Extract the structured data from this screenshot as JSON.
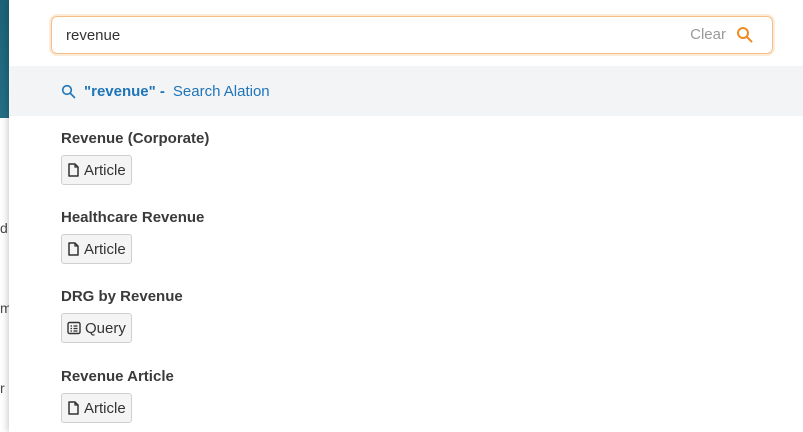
{
  "search": {
    "value": "revenue",
    "clear_label": "Clear"
  },
  "suggestion": {
    "term": "\"revenue\" -",
    "action": "Search Alation"
  },
  "results": [
    {
      "title": "Revenue (Corporate)",
      "type": "Article",
      "icon": "article-icon"
    },
    {
      "title": "Healthcare Revenue",
      "type": "Article",
      "icon": "article-icon"
    },
    {
      "title": "DRG by Revenue",
      "type": "Query",
      "icon": "query-icon"
    },
    {
      "title": "Revenue Article",
      "type": "Article",
      "icon": "article-icon"
    }
  ],
  "background_fragments": [
    "d",
    "m",
    "r"
  ],
  "colors": {
    "accent": "#f08a24",
    "link": "#1f75b8",
    "header": "#1f6a80"
  }
}
